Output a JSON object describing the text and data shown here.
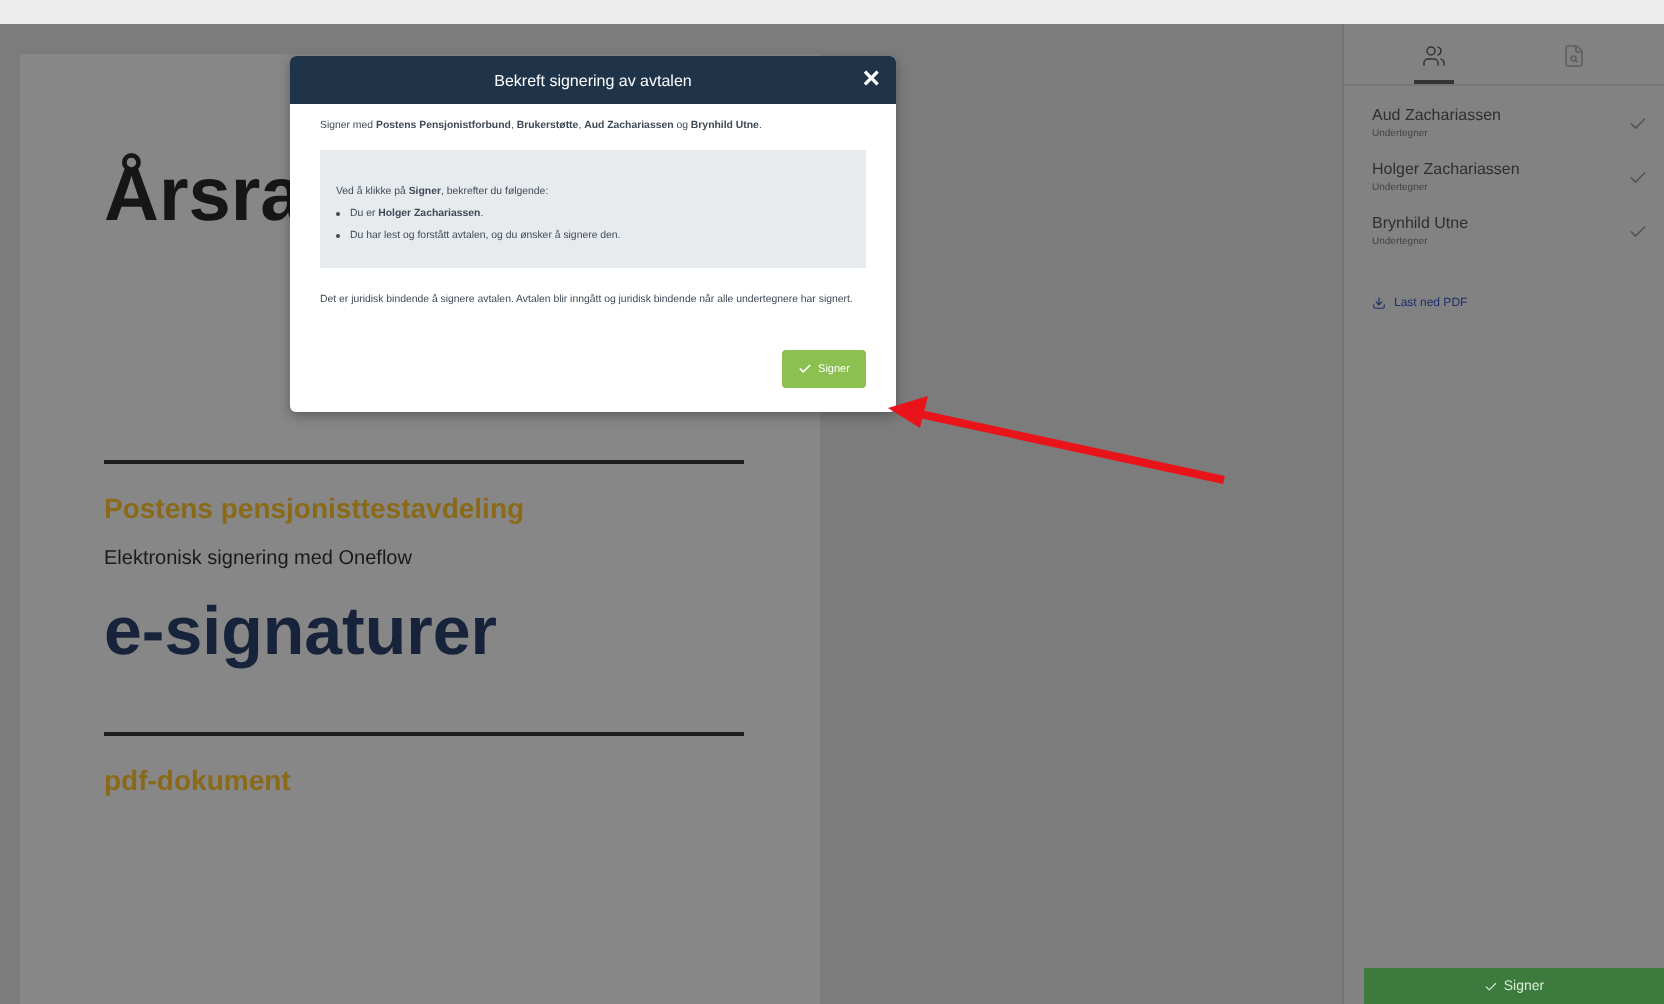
{
  "document": {
    "heading": "Årsra",
    "section_title": "Postens pensjonisttestavdeling",
    "subtitle": "Elektronisk signering med Oneflow",
    "big_title": "e-signaturer",
    "footer_title": "pdf-dokument"
  },
  "sidebar": {
    "tabs": [
      {
        "kind": "people",
        "selected": true
      },
      {
        "kind": "document-search",
        "selected": false
      }
    ],
    "signers": [
      {
        "name": "Aud Zachariassen",
        "role": "Undertegner",
        "signed": true
      },
      {
        "name": "Holger Zachariassen",
        "role": "Undertegner",
        "signed": true
      },
      {
        "name": "Brynhild Utne",
        "role": "Undertegner",
        "signed": true
      }
    ],
    "download_link": "Last ned PDF",
    "sign_button": "Signer"
  },
  "modal": {
    "title": "Bekreft signering av avtalen",
    "close": "×",
    "intro": "Signer med **Postens Pensjonistforbund**, **Brukerstøtte**, **Aud Zachariassen** og **Brynhild Utne**.",
    "box_lead": "Ved å klikke på **Signer**, bekrefter du følgende:",
    "bullets": [
      "Du er **Holger Zachariassen**.",
      "Du har lest og forstått avtalen, og du ønsker å signere den."
    ],
    "note": "Det er juridisk bindende å signere avtalen. Avtalen blir inngått og juridisk bindende når alle undertegnere har signert.",
    "confirm_button": "Signer"
  }
}
